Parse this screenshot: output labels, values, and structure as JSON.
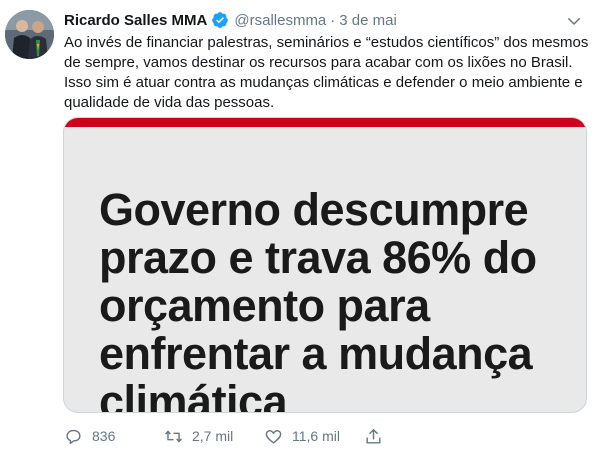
{
  "tweet": {
    "author_name": "Ricardo Salles MMA",
    "handle": "@rsallesmma",
    "separator": "·",
    "time": "3 de mai",
    "text_lines": [
      "Ao invés de financiar palestras, seminários e “estudos científicos” dos mesmos",
      "de sempre, vamos destinar os recursos para acabar com os lixões no Brasil.",
      "Isso sim é atuar contra as mudanças climáticas e defender o meio ambiente e",
      "qualidade de vida das pessoas."
    ]
  },
  "media": {
    "headline_lines": [
      "Governo descumpre",
      "prazo e trava 86% do",
      "orçamento para",
      "enfrentar a mudança",
      "climática"
    ],
    "accent_color": "#d0021b"
  },
  "actions": {
    "replies": "836",
    "retweets": "2,7 mil",
    "likes": "11,6 mil"
  },
  "colors": {
    "verified": "#1da1f2",
    "secondary_text": "#657786"
  }
}
